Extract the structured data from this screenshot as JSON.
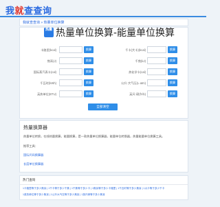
{
  "logo": {
    "part1": "我",
    "part2": "就",
    "part3": "查查询"
  },
  "breadcrumb": "我就查查询 » 热量单位换算",
  "badge": "热量",
  "title": "热量单位换算-能量单位换算",
  "fields_left": [
    {
      "label": "卡路里(kcal)",
      "button": "换算"
    },
    {
      "label": "焦耳(J)",
      "button": "换算"
    },
    {
      "label": "国际蒸汽表卡(cal)",
      "button": "换算"
    },
    {
      "label": "千瓦时(kWh)",
      "button": "换算"
    },
    {
      "label": "英热单位(BTU)",
      "button": "换算"
    }
  ],
  "fields_right": [
    {
      "label": "千卡(大卡)(kcal)",
      "button": "换算"
    },
    {
      "label": "千焦(kJ)",
      "button": "换算"
    },
    {
      "label": "热化学卡(cal)",
      "button": "换算"
    },
    {
      "label": "公升·大气压(L·atm)",
      "button": "换算"
    },
    {
      "label": "英尺·磅(ft·lb)",
      "button": "换算"
    }
  ],
  "clear_button": "全部清空",
  "description": {
    "heading": "热量换算器",
    "body": "热量单位转换，在线热量换算，能量换算，是一款热量单位换算器，能量单位转换器，热量能量单位换算工具。",
    "more": "推荐工具：",
    "links": [
      "国际尺码换算器",
      "长度单位换算器"
    ]
  },
  "hot": {
    "title": "热门查询",
    "line1": "1卡路里等于多少焦耳 | 1千卡等于多少千焦 | 1千焦等于多少卡 | 1焦耳等于多少卡路里 | 1千瓦时等于多少焦耳 | 1大卡等于多少千卡",
    "line2": "1英热单位等于多少焦耳 | 1公升大气压等于多少焦耳 | 1英尺磅等于多少焦耳"
  }
}
